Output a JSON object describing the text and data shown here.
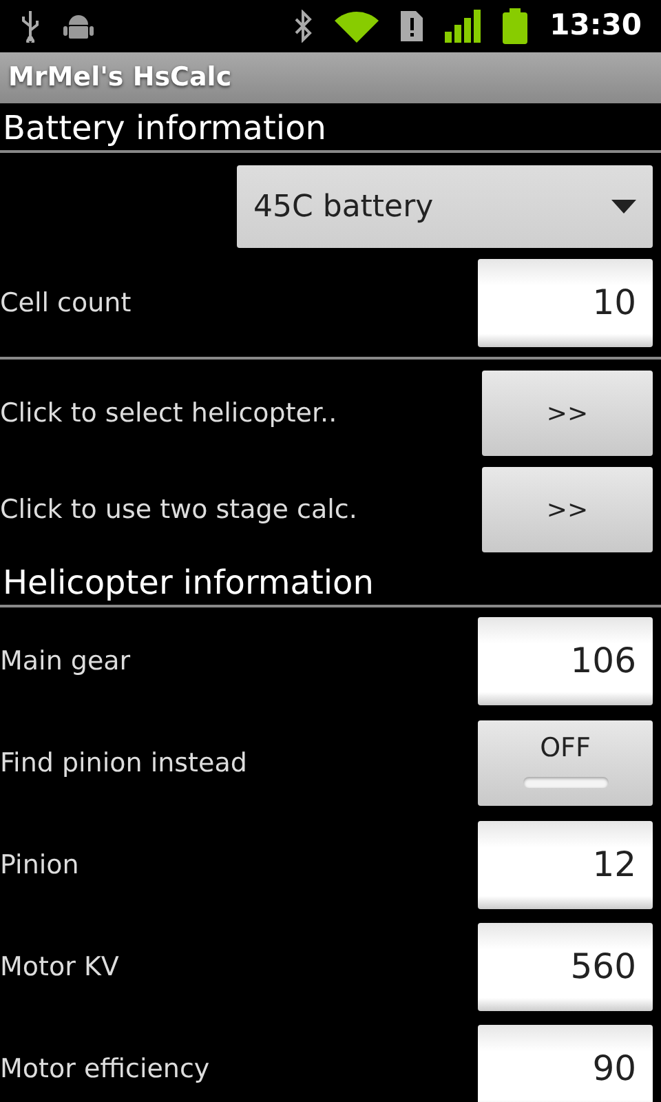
{
  "status_bar": {
    "time": "13:30"
  },
  "window": {
    "title": "MrMel's HsCalc"
  },
  "rows": [
    {
      "kind": "heading",
      "label": "Battery information"
    },
    {
      "kind": "spinner",
      "value": "45C battery"
    },
    {
      "kind": "number",
      "label": "Cell count",
      "value": "10"
    },
    {
      "kind": "divider"
    },
    {
      "kind": "button",
      "label": "Click to select helicopter..",
      "button": ">>"
    },
    {
      "kind": "button",
      "label": "Click to use two stage calc.",
      "button": ">>"
    },
    {
      "kind": "heading",
      "label": "Helicopter information"
    },
    {
      "kind": "number",
      "label": "Main gear",
      "value": "106"
    },
    {
      "kind": "toggle",
      "label": "Find pinion instead",
      "button": "OFF",
      "on": false
    },
    {
      "kind": "number",
      "label": "Pinion",
      "value": "12"
    },
    {
      "kind": "number",
      "label": "Motor KV",
      "value": "560"
    },
    {
      "kind": "number",
      "label": "Motor efficiency",
      "value": "90"
    }
  ]
}
